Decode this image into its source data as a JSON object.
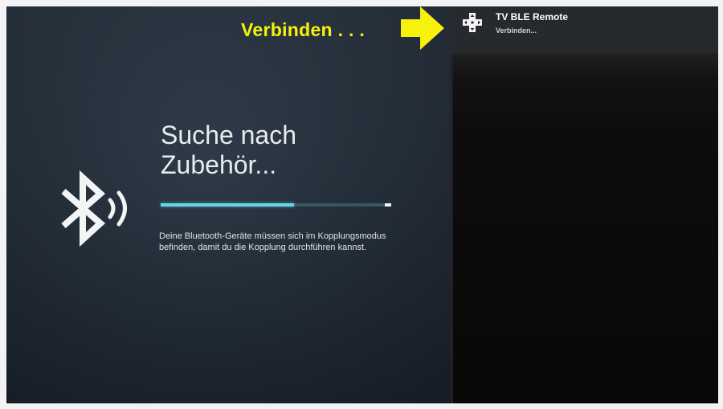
{
  "annotation": {
    "label": "Verbinden . . .",
    "color": "#f7f20c"
  },
  "notification": {
    "icon": "gamepad-dpad-icon",
    "device_name": "TV BLE Remote",
    "status": "Verbinden..."
  },
  "pairing": {
    "icon": "bluetooth-searching-icon",
    "title": "Suche nach Zubehör...",
    "progress": 0.58,
    "hint": "Deine Bluetooth-Geräte müssen sich im Kopplungsmodus befinden, damit du die Kopplung durchführen kannst."
  },
  "colors": {
    "progress_fill": "#67d4e8",
    "progress_track": "#3b5663",
    "panel": "#232e3a"
  }
}
